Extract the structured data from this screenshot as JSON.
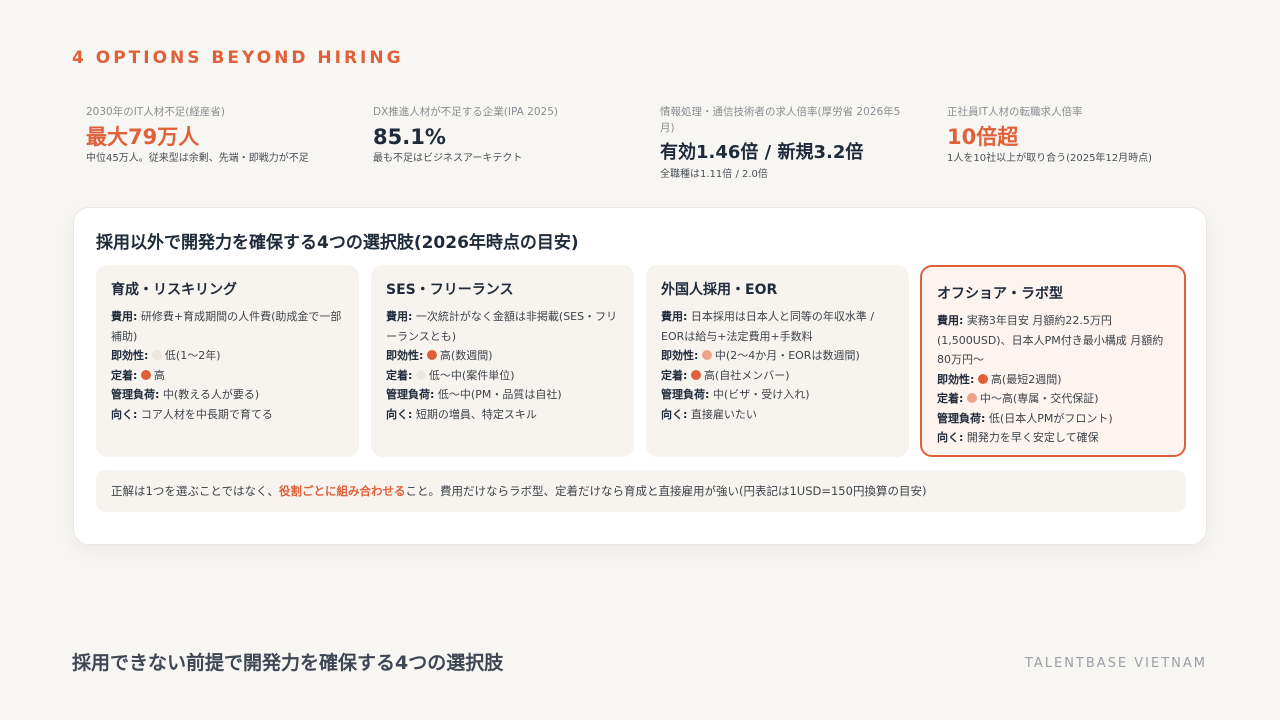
{
  "eyebrow": "4 OPTIONS BEYOND HIRING",
  "stats": [
    {
      "label": "2030年のIT人材不足(経産省)",
      "value": "最大79万人",
      "note": "中位45万人。従来型は余剰、先端・即戦力が不足",
      "color": "#e0603a"
    },
    {
      "label": "DX推進人材が不足する企業(IPA 2025)",
      "value": "85.1%",
      "note": "最も不足はビジネスアーキテクト",
      "color": "#1f2a3a"
    },
    {
      "label": "情報処理・通信技術者の求人倍率(厚労省 2026年5月)",
      "value": "有効1.46倍 / 新規3.2倍",
      "note": "全職種は1.11倍 / 2.0倍",
      "color": "#1f2a3a"
    },
    {
      "label": "正社員IT人材の転職求人倍率",
      "value": "10倍超",
      "note": "1人を10社以上が取り合う(2025年12月時点)",
      "color": "#e0603a"
    }
  ],
  "panel": {
    "title": "採用以外で開発力を確保する4つの選択肢(2026年時点の目安)",
    "cards": [
      {
        "title": "育成・リスキリング",
        "cost_key": "費用:",
        "cost": "研修費+育成期間の人件費(助成金で一部補助)",
        "speed_key": "即効性:",
        "speed": "低(1〜2年)",
        "speed_level": "low",
        "retention_key": "定着:",
        "retention": "高",
        "retention_level": "high",
        "mgmt_key": "管理負荷:",
        "mgmt": "中(教える人が要る)",
        "fit_key": "向く:",
        "fit": "コア人材を中長期で育てる"
      },
      {
        "title": "SES・フリーランス",
        "cost_key": "費用:",
        "cost": "一次統計がなく金額は非掲載(SES・フリーランスとも)",
        "speed_key": "即効性:",
        "speed": "高(数週間)",
        "speed_level": "high",
        "retention_key": "定着:",
        "retention": "低〜中(案件単位)",
        "retention_level": "low",
        "mgmt_key": "管理負荷:",
        "mgmt": "低〜中(PM・品質は自社)",
        "fit_key": "向く:",
        "fit": "短期の増員、特定スキル"
      },
      {
        "title": "外国人採用・EOR",
        "cost_key": "費用:",
        "cost": "日本採用は日本人と同等の年収水準 / EORは給与+法定費用+手数料",
        "speed_key": "即効性:",
        "speed": "中(2〜4か月・EORは数週間)",
        "speed_level": "mid",
        "retention_key": "定着:",
        "retention": "高(自社メンバー)",
        "retention_level": "high",
        "mgmt_key": "管理負荷:",
        "mgmt": "中(ビザ・受け入れ)",
        "fit_key": "向く:",
        "fit": "直接雇いたい"
      },
      {
        "title": "オフショア・ラボ型",
        "cost_key": "費用:",
        "cost": "実務3年目安 月額約22.5万円(1,500USD)、日本人PM付き最小構成 月額約80万円〜",
        "speed_key": "即効性:",
        "speed": "高(最短2週間)",
        "speed_level": "high",
        "retention_key": "定着:",
        "retention": "中〜高(専属・交代保証)",
        "retention_level": "mid",
        "mgmt_key": "管理負荷:",
        "mgmt": "低(日本人PMがフロント)",
        "fit_key": "向く:",
        "fit": "開発力を早く安定して確保"
      }
    ],
    "footnote": {
      "pre": "正解は1つを選ぶことではなく、",
      "emphasis": "役割ごとに組み合わせる",
      "post": "こと。費用だけならラボ型、定着だけなら育成と直接雇用が強い(円表記は1USD=150円換算の目安)"
    }
  },
  "bottom_title": "採用できない前提で開発力を確保する4つの選択肢",
  "brand": "TALENTBASE VIETNAM",
  "colors": {
    "accent": "#e0603a",
    "high": "#e0603a",
    "mid": "#eea48a",
    "low": "#ece7e0"
  }
}
